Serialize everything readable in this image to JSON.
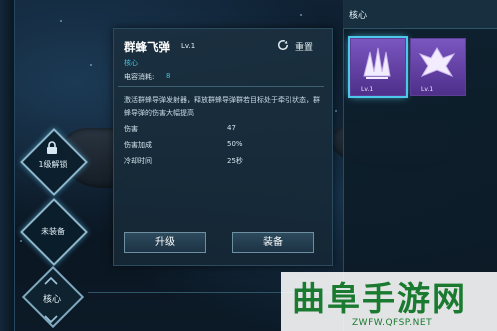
{
  "skill_panel": {
    "title": "群蜂飞弹",
    "level": "Lv.1",
    "category": "核心",
    "capacity_label": "电容消耗:",
    "capacity_value": "8",
    "reset_label": "重置",
    "description": "激活群蜂导弹发射器，释放群蜂导弹群若目标处于牵引状态，群蜂导弹的伤害大幅提高",
    "stats": [
      {
        "label": "伤害",
        "value": "47"
      },
      {
        "label": "伤害加成",
        "value": "50%"
      },
      {
        "label": "冷却时间",
        "value": "25秒"
      }
    ],
    "upgrade_label": "升级",
    "equip_label": "装备"
  },
  "right_panel": {
    "header": "核心",
    "cards": [
      {
        "level": "Lv.1",
        "icon": "claw-emblem-icon",
        "selected": true
      },
      {
        "level": "Lv.1",
        "icon": "wing-emblem-icon",
        "selected": false
      }
    ]
  },
  "left_controls": {
    "locked_label": "1级解锁",
    "unequipped_label": "未装备"
  },
  "bottom": {
    "core_label": "核心"
  },
  "watermark": {
    "text": "曲阜手游网",
    "url": "ZWFW.QFSP.NET"
  },
  "colors": {
    "accent_cyan": "#44c4e0",
    "card_purple": "#6a47b0",
    "watermark_green": "#1a7a2f"
  }
}
